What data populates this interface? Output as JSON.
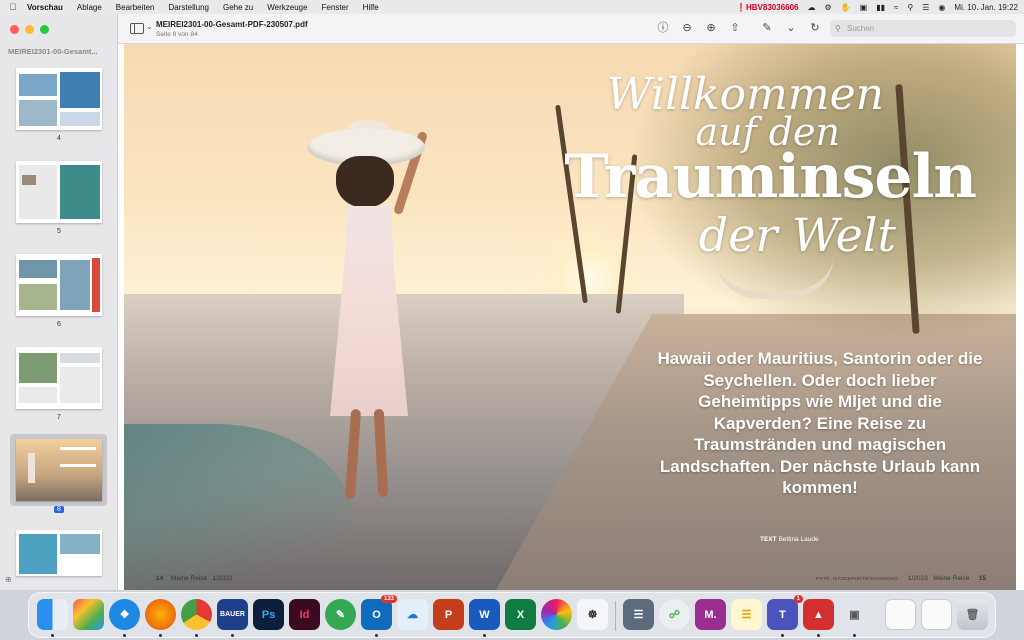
{
  "menubar": {
    "app_name": "Vorschau",
    "items": [
      "Ablage",
      "Bearbeiten",
      "Darstellung",
      "Gehe zu",
      "Werkzeuge",
      "Fenster",
      "Hilfe"
    ],
    "hostname": "HBV83036606",
    "clock": "Mi. 10. Jan.  19:22"
  },
  "sidebar": {
    "title": "MEIREI2301-00-Gesamt...",
    "pages": [
      "4",
      "5",
      "6",
      "7",
      "8"
    ],
    "selected_page": "8"
  },
  "toolbar": {
    "doc_title": "MEIREI2301-00-Gesamt-PDF-230507.pdf",
    "doc_subtitle": "Seite 8 von 84",
    "search_placeholder": "Suchen"
  },
  "document": {
    "headline_1": "Willkommen",
    "headline_2": "auf den",
    "headline_3": "Trauminseln",
    "headline_4": "der Welt",
    "body": "Hawaii oder Mauritius, Santorin oder die Seychellen. Oder doch lieber Geheimtipps wie Mljet und die Kapverden? Eine Reise zu Traumstränden und magischen Landschaften. Der nächste Urlaub kann kommen!",
    "credit_label": "TEXT",
    "credit_name": "Bettina Laude",
    "footer_left_page": "14",
    "footer_left_mag": "Meine Reise",
    "footer_left_issue": "1/2023",
    "photo_credit": "FOTO: ISTOCKPHOTO/SHANSOKO",
    "footer_right_issue": "1/2023",
    "footer_right_mag": "Meine Reise",
    "footer_right_page": "15"
  },
  "dock": {
    "outlook_badge": "133",
    "teams_badge": "1",
    "bauer_label": "BAUER",
    "ps_label": "Ps",
    "id_label": "Id",
    "m_label": "M."
  },
  "colors": {
    "selection": "#2a62e0",
    "warn": "#d0021b"
  }
}
